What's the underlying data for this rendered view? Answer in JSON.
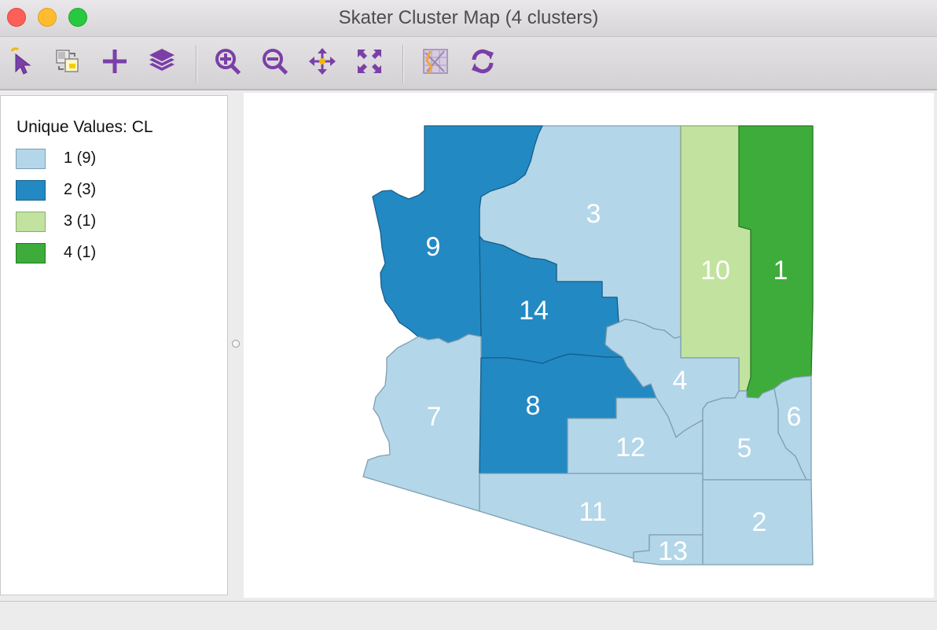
{
  "window": {
    "title": "Skater Cluster Map (4 clusters)"
  },
  "toolbar": {
    "tools": [
      {
        "name": "select-tool",
        "icon": "cursor-arrow-icon"
      },
      {
        "name": "selection-mode-tool",
        "icon": "select-copy-icon"
      },
      {
        "name": "add-tool",
        "icon": "plus-icon"
      },
      {
        "name": "layers-tool",
        "icon": "layers-icon"
      },
      {
        "name": "zoom-in-tool",
        "icon": "zoom-in-icon"
      },
      {
        "name": "zoom-out-tool",
        "icon": "zoom-out-icon"
      },
      {
        "name": "pan-tool",
        "icon": "pan-move-icon"
      },
      {
        "name": "fit-extent-tool",
        "icon": "fit-extent-icon"
      },
      {
        "name": "basemap-tool",
        "icon": "basemap-icon"
      },
      {
        "name": "refresh-tool",
        "icon": "refresh-icon"
      }
    ],
    "icon_color": "#7b3fa8"
  },
  "legend": {
    "title": "Unique Values: CL",
    "items": [
      {
        "label": "1 (9)",
        "color": "#b3d6e8",
        "border": "#7f9fb3"
      },
      {
        "label": "2 (3)",
        "color": "#2389c3",
        "border": "#155f8a"
      },
      {
        "label": "3 (1)",
        "color": "#c1e39f",
        "border": "#8dab70"
      },
      {
        "label": "4 (1)",
        "color": "#3dac3a",
        "border": "#257a23"
      }
    ]
  },
  "map": {
    "regions": [
      {
        "id": "1",
        "cluster": 4
      },
      {
        "id": "2",
        "cluster": 1
      },
      {
        "id": "3",
        "cluster": 1
      },
      {
        "id": "4",
        "cluster": 1
      },
      {
        "id": "5",
        "cluster": 1
      },
      {
        "id": "6",
        "cluster": 1
      },
      {
        "id": "7",
        "cluster": 1
      },
      {
        "id": "8",
        "cluster": 2
      },
      {
        "id": "9",
        "cluster": 2
      },
      {
        "id": "10",
        "cluster": 3
      },
      {
        "id": "11",
        "cluster": 1
      },
      {
        "id": "12",
        "cluster": 1
      },
      {
        "id": "13",
        "cluster": 1
      },
      {
        "id": "14",
        "cluster": 2
      }
    ]
  }
}
